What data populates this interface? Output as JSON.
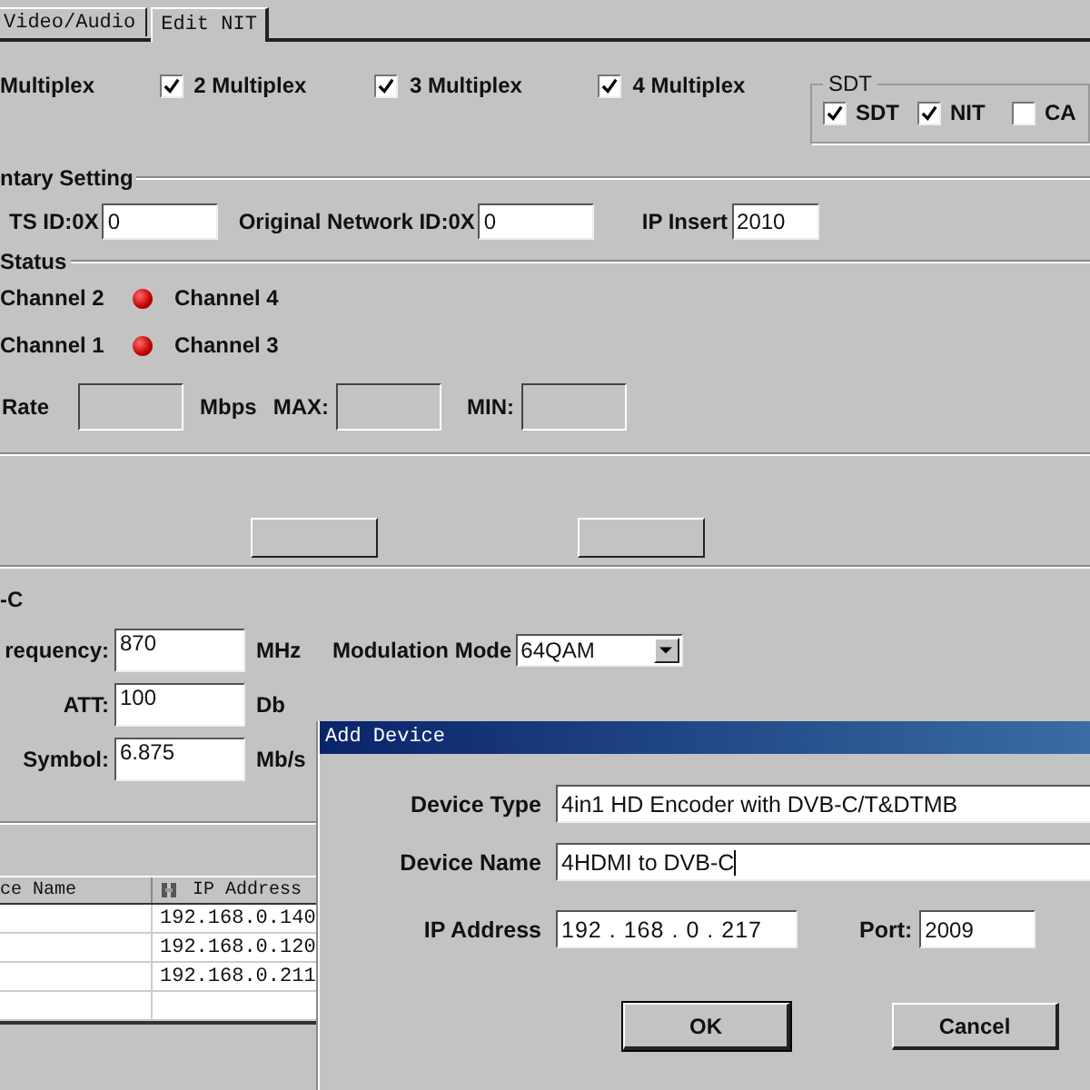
{
  "tabs": [
    {
      "label": "Video/Audio",
      "selected": false
    },
    {
      "label": "Edit NIT",
      "selected": true
    }
  ],
  "multiplex": {
    "cut_label": "Multiplex",
    "options": [
      {
        "label": "2 Multiplex",
        "checked": true
      },
      {
        "label": "3 Multiplex",
        "checked": true
      },
      {
        "label": "4 Multiplex",
        "checked": true
      }
    ]
  },
  "sdt": {
    "title": "SDT",
    "options": [
      {
        "label": "SDT",
        "checked": true
      },
      {
        "label": "NIT",
        "checked": true
      },
      {
        "label": "CA",
        "checked": false
      }
    ]
  },
  "elementary_setting": {
    "title": "ntary Setting",
    "ts_id_label": "TS ID:0X",
    "ts_id": "0",
    "onid_label": "Original Network ID:0X",
    "onid": "0",
    "ip_insert_label": "IP Insert",
    "ip_insert": "2010"
  },
  "status": {
    "title": "Status",
    "rows": [
      [
        "Channel 2",
        "Channel 4"
      ],
      [
        "Channel 1",
        "Channel 3"
      ]
    ],
    "rate_label": "Rate",
    "rate_unit": "Mbps",
    "max_label": "MAX:",
    "min_label": "MIN:"
  },
  "dvbc": {
    "title": "-C",
    "frequency_label": "requency:",
    "frequency": "870",
    "frequency_unit": "MHz",
    "modulation_label": "Modulation Mode",
    "modulation": "64QAM",
    "att_label": "ATT:",
    "att": "100",
    "att_unit": "Db",
    "symbol_label": "Symbol:",
    "symbol": "6.875",
    "symbol_unit": "Mb/s"
  },
  "table": {
    "columns": [
      "ce Name",
      "IP Address"
    ],
    "rows": [
      {
        "ip_address": "192.168.0.140"
      },
      {
        "ip_address": "192.168.0.120"
      },
      {
        "ip_address": "192.168.0.211"
      }
    ]
  },
  "dialog": {
    "title": "Add Device",
    "device_type_label": "Device Type",
    "device_type": "4in1 HD Encoder with DVB-C/T&DTMB",
    "device_name_label": "Device Name",
    "device_name": "4HDMI to DVB-C",
    "ip_label": "IP Address",
    "ip_parts": [
      "192",
      "168",
      "0",
      "217"
    ],
    "ip_separator": ".",
    "port_label": "Port:",
    "port": "2009",
    "buttons": [
      "OK",
      "Cancel"
    ]
  }
}
